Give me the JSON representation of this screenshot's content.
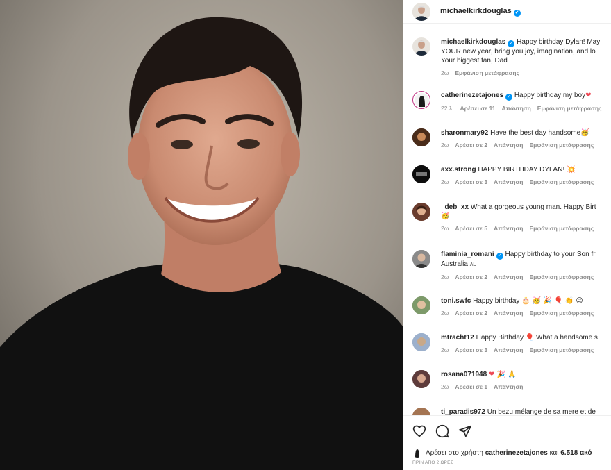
{
  "post": {
    "author": "michaelkirkdouglas",
    "caption_lines": [
      "Happy birthday Dylan! May",
      "YOUR new year, bring you joy, imagination, and lo",
      "Your biggest fan, Dad"
    ],
    "caption_time": "2ω",
    "see_translation": "Εμφάνιση μετάφρασης"
  },
  "comments": [
    {
      "user": "catherinezetajones",
      "verified": true,
      "text": "Happy birthday my boy",
      "emoji": "❤",
      "time": "22 λ.",
      "likes": "Αρέσει σε 11",
      "reply": "Απάντηση",
      "translate": "Εμφάνιση μετάφρασης"
    },
    {
      "user": "sharonmary92",
      "verified": false,
      "text": "Have the best day handsome",
      "emoji": "🥳",
      "time": "2ω",
      "likes": "Αρέσει σε 2",
      "reply": "Απάντηση",
      "translate": "Εμφάνιση μετάφρασης"
    },
    {
      "user": "axx.strong",
      "verified": false,
      "text": "HAPPY BIRTHDAY DYLAN!",
      "emoji": "💥",
      "time": "2ω",
      "likes": "Αρέσει σε 3",
      "reply": "Απάντηση",
      "translate": "Εμφάνιση μετάφρασης"
    },
    {
      "user": "_deb_xx",
      "verified": false,
      "text": "What a gorgeous young man. Happy Birt",
      "emoji": "🥳",
      "time": "2ω",
      "likes": "Αρέσει σε 5",
      "reply": "Απάντηση",
      "translate": "Εμφάνιση μετάφρασης"
    },
    {
      "user": "flaminia_romani",
      "verified": true,
      "text": "Happy birthday to your Son fr",
      "line2": "Australia",
      "line2_flag": "AU",
      "time": "2ω",
      "likes": "Αρέσει σε 2",
      "reply": "Απάντηση",
      "translate": "Εμφάνιση μετάφρασης"
    },
    {
      "user": "toni.swfc",
      "verified": false,
      "text": "Happy birthday",
      "emoji": "🎂 🥳 🎉 🎈 👏 😊",
      "time": "2ω",
      "likes": "Αρέσει σε 2",
      "reply": "Απάντηση",
      "translate": "Εμφάνιση μετάφρασης"
    },
    {
      "user": "mtracht12",
      "verified": false,
      "text": "Happy Birthday",
      "emoji": "🎈",
      "text2": "What a handsome s",
      "time": "2ω",
      "likes": "Αρέσει σε 3",
      "reply": "Απάντηση",
      "translate": "Εμφάνιση μετάφρασης"
    },
    {
      "user": "rosana071948",
      "verified": false,
      "text": "",
      "emoji": "❤ 🎉 🙏",
      "time": "2ω",
      "likes": "Αρέσει σε 1",
      "reply": "Απάντηση"
    },
    {
      "user": "ti_paradis972",
      "verified": false,
      "text": "Un bezu mélange de sa mere et de"
    }
  ],
  "footer": {
    "liked_prefix": "Αρέσει στο χρήστη",
    "liked_user": "catherinezetajones",
    "liked_and": "και",
    "liked_count": "6.518 ακό",
    "posted_ago": "ΠΡΙΝ ΑΠΟ 2 ΩΡΕΣ"
  },
  "icons": [
    "heart-icon",
    "comment-icon",
    "share-icon",
    "verified-badge-icon"
  ],
  "colors": {
    "verified": "#0095f6",
    "muted": "#8e8e8e",
    "text": "#262626",
    "heart": "#ed4956"
  }
}
